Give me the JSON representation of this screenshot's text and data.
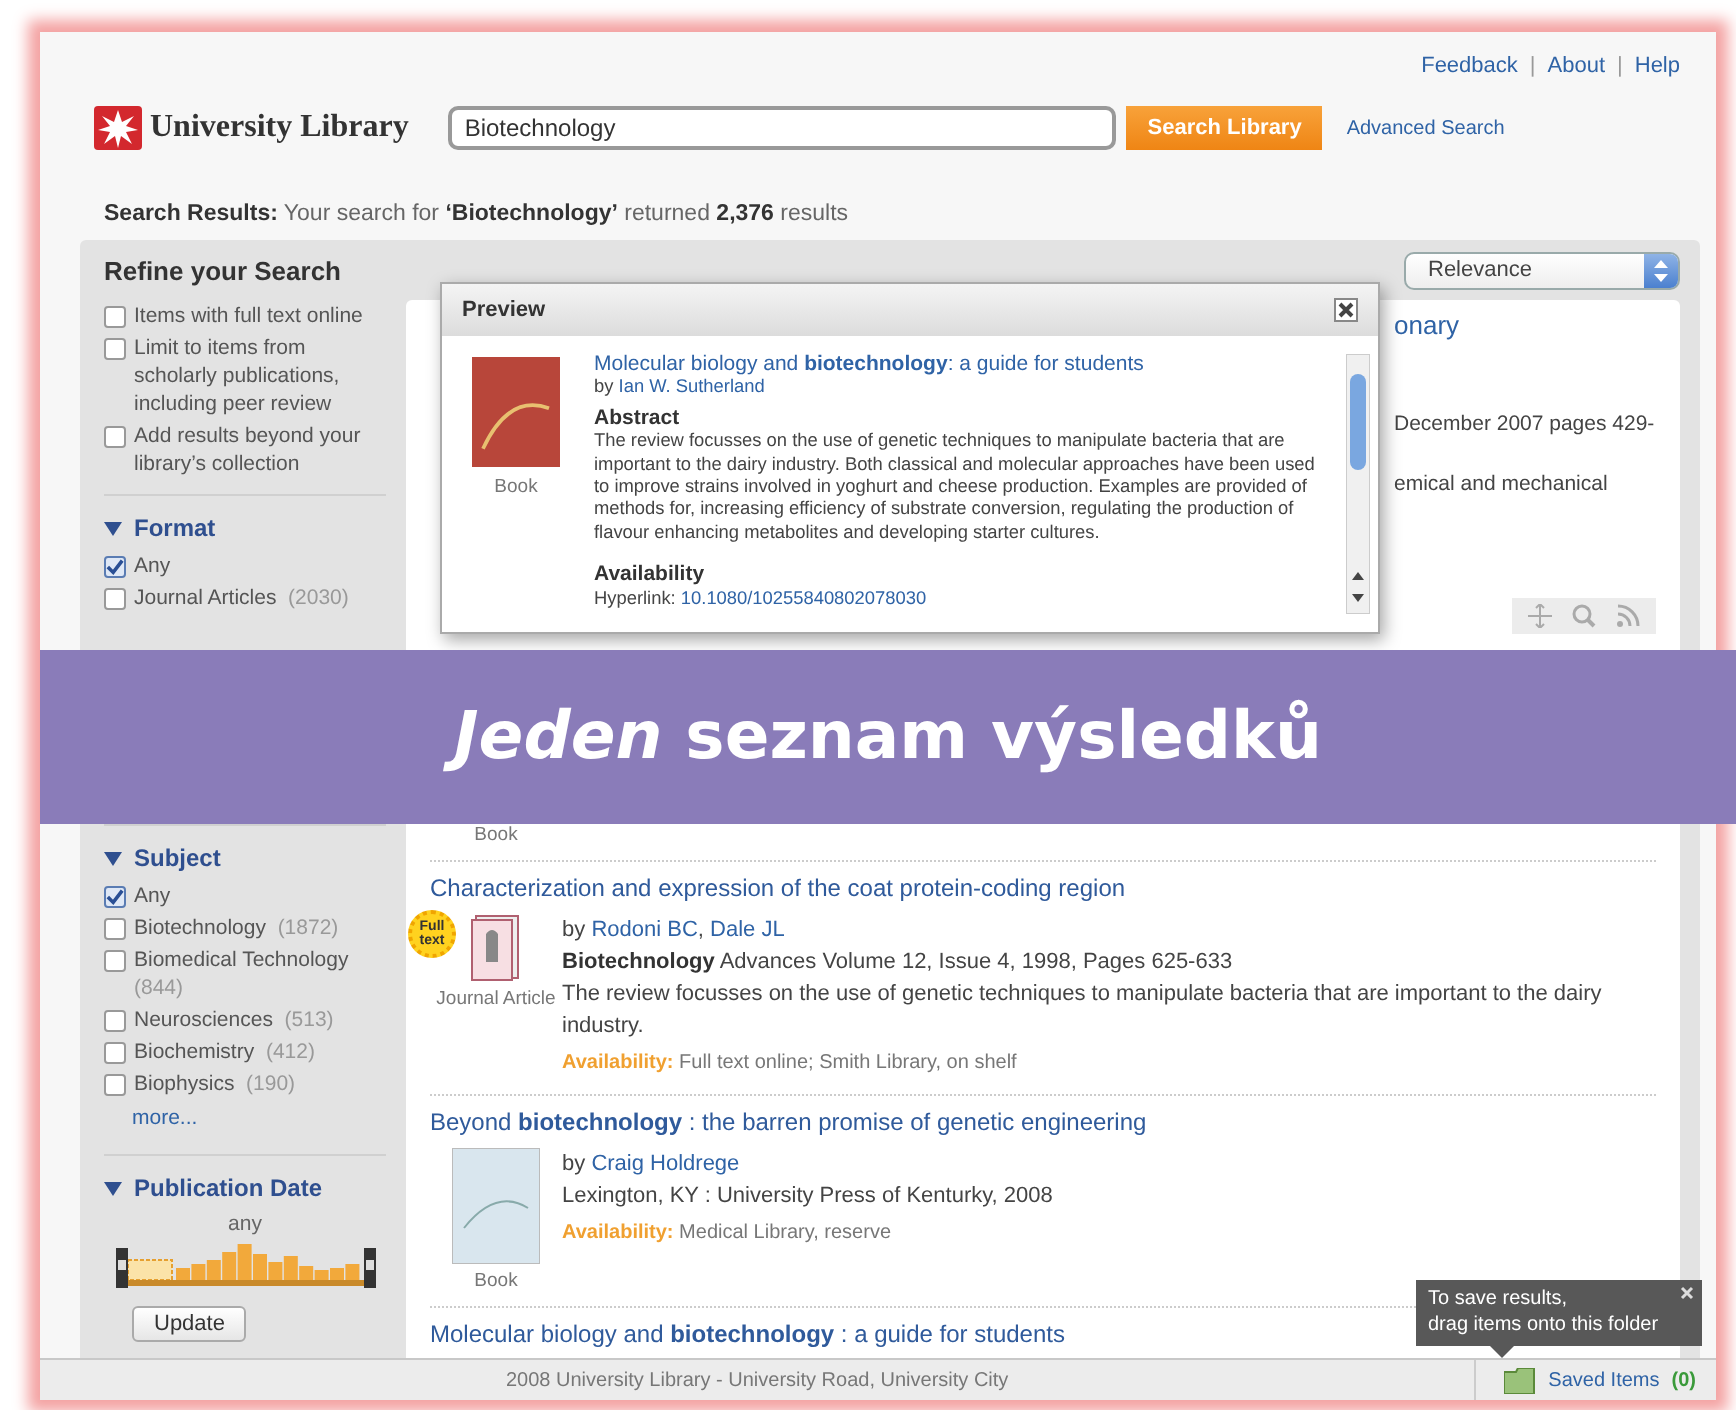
{
  "top_links": [
    "Feedback",
    "About",
    "Help"
  ],
  "link_separator": "|",
  "logo": {
    "name": "University Library"
  },
  "search": {
    "value": "Biotechnology",
    "button": "Search Library",
    "advanced": "Advanced Search"
  },
  "summary": "**Search Results:** Your search for **‘Biotechnology’** returned **2,376** results",
  "sort": {
    "value": "Relevance"
  },
  "sidebar": {
    "title": "Refine your Search",
    "options": [
      {
        "label": "Items with full text online",
        "checked": false
      },
      {
        "label": "Limit to items from scholarly publications, including peer review",
        "checked": false
      },
      {
        "label": "Add results beyond your library’s collection",
        "checked": false
      }
    ],
    "facets": [
      {
        "title": "Format",
        "expanded": true,
        "options": [
          {
            "label": "Any",
            "checked": true
          },
          {
            "label": "Journal Articles",
            "count": "(2030)",
            "checked": false
          }
        ]
      },
      {
        "title": "Subject",
        "expanded": true,
        "more": "more...",
        "options": [
          {
            "label": "Any",
            "checked": true
          },
          {
            "label": "Biotechnology",
            "count": "(1872)",
            "checked": false
          },
          {
            "label": "Biomedical Technology",
            "count": "(844)",
            "checked": false
          },
          {
            "label": "Neurosciences",
            "count": "(513)",
            "checked": false
          },
          {
            "label": "Biochemistry",
            "count": "(412)",
            "checked": false
          },
          {
            "label": "Biophysics",
            "count": "(190)",
            "checked": false
          }
        ]
      }
    ],
    "date": {
      "title": "Publication Date",
      "expanded": true,
      "range": "any",
      "button": "Update"
    }
  },
  "covered_result": {
    "lines": [
      "onary",
      "December 2007 pages 429-",
      "emical and mechanical"
    ]
  },
  "results": [
    {
      "hovered": true,
      "format": "Book"
    },
    {
      "title": "Characterization and expression of the coat protein-coding region",
      "hovered": false,
      "badge": "Full text",
      "kind": "journal",
      "format": "Journal Article",
      "by_label": "by",
      "authors": [
        "Rodoni BC",
        "Dale JL"
      ],
      "author_separator": ",",
      "source": "**Biotechnology** Advances Volume 12, Issue 4, 1998, Pages 625-633",
      "description": "The review focusses on the use of genetic techniques to manipulate bacteria that are important to the dairy industry.",
      "availability_label": "Availability:",
      "availability": "Full text online; Smith Library, on shelf"
    },
    {
      "title": "Beyond **biotechnology** : the barren promise of genetic engineering",
      "hovered": false,
      "kind": "book",
      "format": "Book",
      "by_label": "by",
      "authors": [
        "Craig Holdrege"
      ],
      "source": "Lexington, KY : University Press of Kenturky, 2008",
      "availability_label": "Availability:",
      "availability": "Medical Library, reserve"
    },
    {
      "title": "Molecular biology and **biotechnology** : a guide for students",
      "hovered": false
    }
  ],
  "preview": {
    "title": "Preview",
    "book_title": "Molecular biology and **biotechnology**: a guide for students",
    "by_label": "by",
    "author": "Ian W. Sutherland",
    "format": "Book",
    "abstract_heading": "Abstract",
    "abstract": "The review focusses on the use of genetic techniques to manipulate bacteria that are important to the dairy industry. Both classical and molecular approaches have been used to improve strains involved in yoghurt and cheese production. Examples are provided of methods for, increasing efficiency of substrate conversion, regulating the production of flavour enhancing metabolites and developing starter cultures.",
    "availability_heading": "Availability",
    "hyperlink_label": "Hyperlink:",
    "hyperlink": "10.1080/10255840802078030"
  },
  "footer": {
    "text": "2008 University Library - University Road, University City",
    "saved_label": "Saved Items",
    "saved_count": "(0)"
  },
  "tooltip": {
    "text": "To save results,\ndrag items onto this folder"
  },
  "banner": {
    "text": "*Jeden* seznam výsledků"
  }
}
